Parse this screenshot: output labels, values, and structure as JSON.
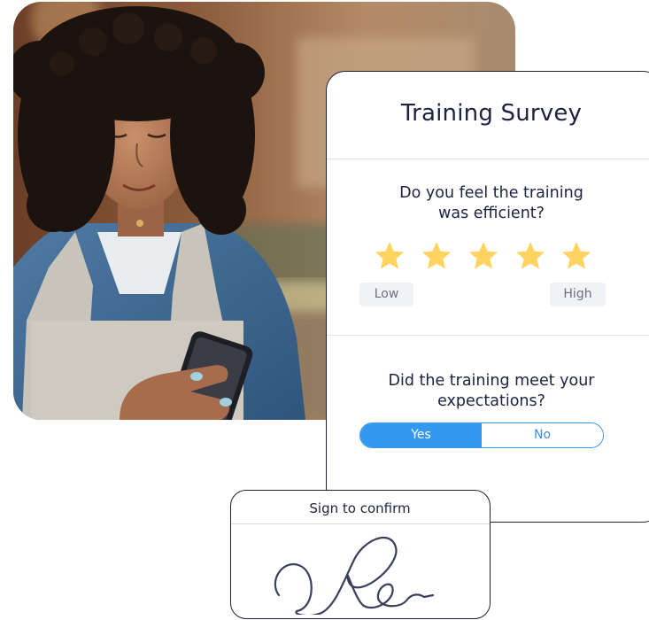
{
  "survey": {
    "title": "Training Survey",
    "question1": {
      "line1": "Do you feel the training",
      "line2": "was efficient?",
      "rating": 5,
      "max_rating": 5,
      "star_color": "#FFD360",
      "low_label": "Low",
      "high_label": "High"
    },
    "question2": {
      "line1": "Did the training meet your",
      "line2": "expectations?",
      "options": [
        "Yes",
        "No"
      ],
      "selected": "Yes",
      "accent_color": "#3398F2"
    }
  },
  "signature_panel": {
    "title": "Sign to confirm"
  }
}
